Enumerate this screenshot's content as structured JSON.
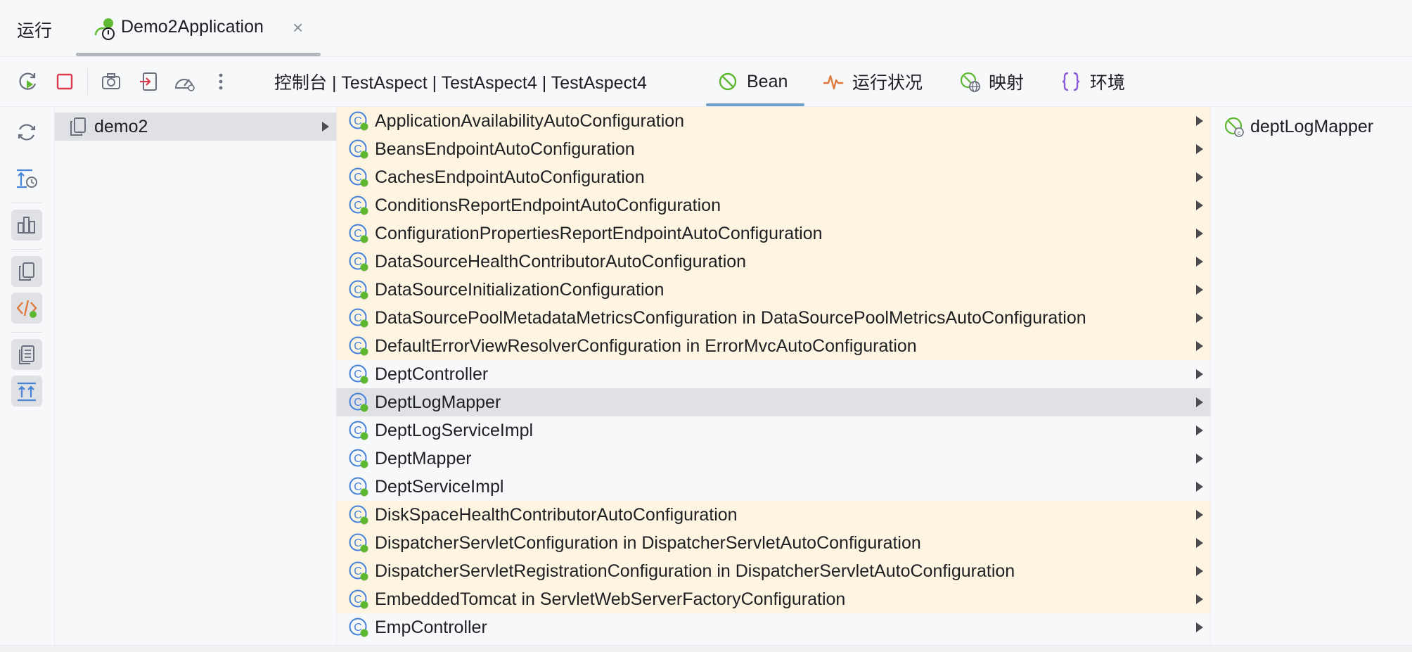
{
  "run_bar": {
    "label": "运行",
    "tab_title": "Demo2Application",
    "tab_close": "×"
  },
  "toolbar": {
    "buttons": [
      "rerun-icon",
      "stop-icon",
      "camera-icon",
      "exit-icon",
      "performance-icon",
      "more-icon"
    ],
    "console_tab": "控制台 | TestAspect | TestAspect4 | TestAspect4",
    "tabs": [
      {
        "label": "Bean",
        "icon": "bean-icon",
        "active": true
      },
      {
        "label": "运行状况",
        "icon": "health-icon",
        "active": false
      },
      {
        "label": "映射",
        "icon": "mapping-icon",
        "active": false
      },
      {
        "label": "环境",
        "icon": "environment-icon",
        "active": false
      }
    ]
  },
  "colors": {
    "accent": "#6f9ec9",
    "autoconfig_row": "#fdf5e2",
    "selected_row": "#dfe1e5",
    "stop_red": "#db3b4b",
    "spring_green": "#5fb832",
    "class_blue": "#4682d8"
  },
  "left_pane": {
    "items": [
      {
        "label": "demo2",
        "selected": true
      }
    ]
  },
  "bean_list": {
    "items": [
      {
        "label": "ApplicationAvailabilityAutoConfiguration",
        "auto": true
      },
      {
        "label": "BeansEndpointAutoConfiguration",
        "auto": true
      },
      {
        "label": "CachesEndpointAutoConfiguration",
        "auto": true
      },
      {
        "label": "ConditionsReportEndpointAutoConfiguration",
        "auto": true
      },
      {
        "label": "ConfigurationPropertiesReportEndpointAutoConfiguration",
        "auto": true
      },
      {
        "label": "DataSourceHealthContributorAutoConfiguration",
        "auto": true
      },
      {
        "label": "DataSourceInitializationConfiguration",
        "auto": true
      },
      {
        "label": "DataSourcePoolMetadataMetricsConfiguration in DataSourcePoolMetricsAutoConfiguration",
        "auto": true
      },
      {
        "label": "DefaultErrorViewResolverConfiguration in ErrorMvcAutoConfiguration",
        "auto": true
      },
      {
        "label": "DeptController",
        "auto": false
      },
      {
        "label": "DeptLogMapper",
        "auto": false,
        "selected": true
      },
      {
        "label": "DeptLogServiceImpl",
        "auto": false
      },
      {
        "label": "DeptMapper",
        "auto": false
      },
      {
        "label": "DeptServiceImpl",
        "auto": false
      },
      {
        "label": "DiskSpaceHealthContributorAutoConfiguration",
        "auto": true
      },
      {
        "label": "DispatcherServletConfiguration in DispatcherServletAutoConfiguration",
        "auto": true
      },
      {
        "label": "DispatcherServletRegistrationConfiguration in DispatcherServletAutoConfiguration",
        "auto": true
      },
      {
        "label": "EmbeddedTomcat in ServletWebServerFactoryConfiguration",
        "auto": true
      },
      {
        "label": "EmpController",
        "auto": false
      }
    ]
  },
  "detail_pane": {
    "items": [
      {
        "label": "deptLogMapper"
      }
    ]
  },
  "rail": {
    "buttons": [
      {
        "icon": "refresh-icon",
        "selected": false
      },
      {
        "icon": "sort-timing-icon",
        "selected": false
      },
      {
        "icon": "bar-chart-icon",
        "selected": true
      },
      {
        "icon": "copy-icon",
        "selected": true
      },
      {
        "icon": "code-icon",
        "selected": true
      },
      {
        "icon": "document-icon",
        "selected": true
      },
      {
        "icon": "expand-icon",
        "selected": true
      }
    ]
  }
}
